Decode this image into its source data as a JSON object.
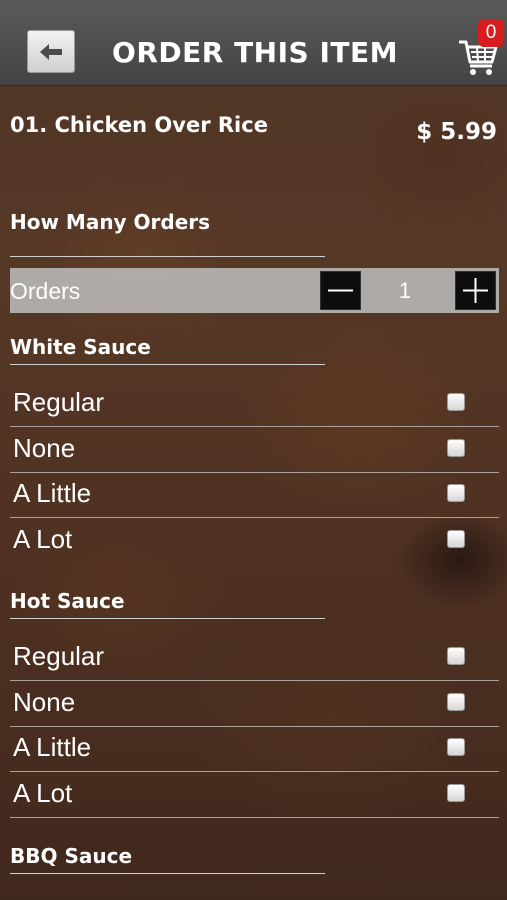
{
  "header": {
    "title": "ORDER THIS ITEM",
    "cart_count": "0"
  },
  "item": {
    "name": "01. Chicken Over Rice",
    "price": "$ 5.99"
  },
  "quantity_section": {
    "title": "How Many Orders",
    "label": "Orders",
    "value": "1"
  },
  "sections": [
    {
      "title": "White Sauce",
      "options": [
        "Regular",
        "None",
        "A Little",
        "A Lot"
      ]
    },
    {
      "title": "Hot Sauce",
      "options": [
        "Regular",
        "None",
        "A Little",
        "A Lot"
      ]
    },
    {
      "title": "BBQ Sauce",
      "options": []
    }
  ],
  "icons": {
    "back": "left-arrow-icon",
    "cart": "shopping-cart-icon",
    "minus": "minus-icon",
    "plus": "plus-icon"
  },
  "colors": {
    "badge": "#d61e1e",
    "header": "#4f4f4f"
  }
}
